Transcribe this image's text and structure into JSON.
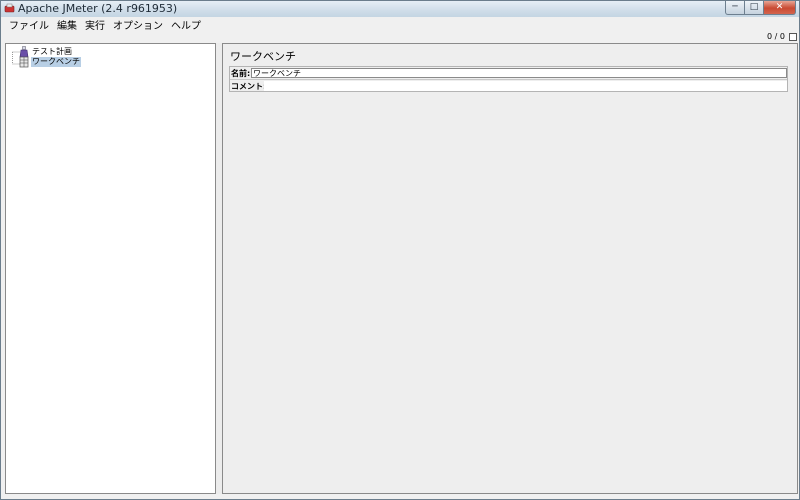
{
  "window": {
    "title": "Apache JMeter (2.4 r961953)"
  },
  "menu": {
    "items": [
      {
        "label": "ファイル"
      },
      {
        "label": "編集"
      },
      {
        "label": "実行"
      },
      {
        "label": "オプション"
      },
      {
        "label": "ヘルプ"
      }
    ]
  },
  "status": {
    "counter": "0 / 0"
  },
  "tree": {
    "nodes": [
      {
        "label": "テスト計画",
        "icon": "test-plan-icon",
        "selected": false
      },
      {
        "label": "ワークベンチ",
        "icon": "workbench-icon",
        "selected": true
      }
    ]
  },
  "content": {
    "title": "ワークベンチ",
    "name_label": "名前:",
    "name_value": "ワークベンチ",
    "comment_label": "コメント:",
    "comment_value": ""
  },
  "colors": {
    "selection": "#b8cfe5",
    "panel_bg": "#eeeeee",
    "close_button": "#c94a32"
  }
}
